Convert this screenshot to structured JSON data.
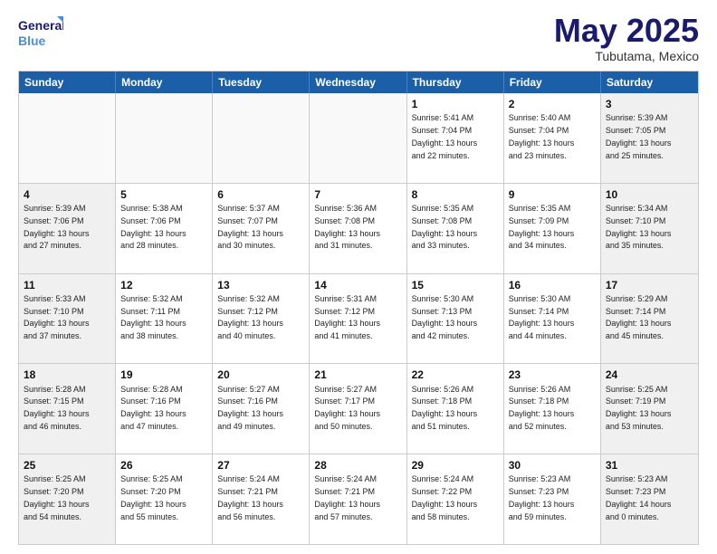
{
  "logo": {
    "line1": "General",
    "line2": "Blue"
  },
  "title": "May 2025",
  "location": "Tubutama, Mexico",
  "days": [
    "Sunday",
    "Monday",
    "Tuesday",
    "Wednesday",
    "Thursday",
    "Friday",
    "Saturday"
  ],
  "rows": [
    [
      {
        "day": "",
        "content": "",
        "empty": true
      },
      {
        "day": "",
        "content": "",
        "empty": true
      },
      {
        "day": "",
        "content": "",
        "empty": true
      },
      {
        "day": "",
        "content": "",
        "empty": true
      },
      {
        "day": "1",
        "content": "Sunrise: 5:41 AM\nSunset: 7:04 PM\nDaylight: 13 hours\nand 22 minutes.",
        "empty": false
      },
      {
        "day": "2",
        "content": "Sunrise: 5:40 AM\nSunset: 7:04 PM\nDaylight: 13 hours\nand 23 minutes.",
        "empty": false
      },
      {
        "day": "3",
        "content": "Sunrise: 5:39 AM\nSunset: 7:05 PM\nDaylight: 13 hours\nand 25 minutes.",
        "empty": false
      }
    ],
    [
      {
        "day": "4",
        "content": "Sunrise: 5:39 AM\nSunset: 7:06 PM\nDaylight: 13 hours\nand 27 minutes.",
        "empty": false
      },
      {
        "day": "5",
        "content": "Sunrise: 5:38 AM\nSunset: 7:06 PM\nDaylight: 13 hours\nand 28 minutes.",
        "empty": false
      },
      {
        "day": "6",
        "content": "Sunrise: 5:37 AM\nSunset: 7:07 PM\nDaylight: 13 hours\nand 30 minutes.",
        "empty": false
      },
      {
        "day": "7",
        "content": "Sunrise: 5:36 AM\nSunset: 7:08 PM\nDaylight: 13 hours\nand 31 minutes.",
        "empty": false
      },
      {
        "day": "8",
        "content": "Sunrise: 5:35 AM\nSunset: 7:08 PM\nDaylight: 13 hours\nand 33 minutes.",
        "empty": false
      },
      {
        "day": "9",
        "content": "Sunrise: 5:35 AM\nSunset: 7:09 PM\nDaylight: 13 hours\nand 34 minutes.",
        "empty": false
      },
      {
        "day": "10",
        "content": "Sunrise: 5:34 AM\nSunset: 7:10 PM\nDaylight: 13 hours\nand 35 minutes.",
        "empty": false
      }
    ],
    [
      {
        "day": "11",
        "content": "Sunrise: 5:33 AM\nSunset: 7:10 PM\nDaylight: 13 hours\nand 37 minutes.",
        "empty": false
      },
      {
        "day": "12",
        "content": "Sunrise: 5:32 AM\nSunset: 7:11 PM\nDaylight: 13 hours\nand 38 minutes.",
        "empty": false
      },
      {
        "day": "13",
        "content": "Sunrise: 5:32 AM\nSunset: 7:12 PM\nDaylight: 13 hours\nand 40 minutes.",
        "empty": false
      },
      {
        "day": "14",
        "content": "Sunrise: 5:31 AM\nSunset: 7:12 PM\nDaylight: 13 hours\nand 41 minutes.",
        "empty": false
      },
      {
        "day": "15",
        "content": "Sunrise: 5:30 AM\nSunset: 7:13 PM\nDaylight: 13 hours\nand 42 minutes.",
        "empty": false
      },
      {
        "day": "16",
        "content": "Sunrise: 5:30 AM\nSunset: 7:14 PM\nDaylight: 13 hours\nand 44 minutes.",
        "empty": false
      },
      {
        "day": "17",
        "content": "Sunrise: 5:29 AM\nSunset: 7:14 PM\nDaylight: 13 hours\nand 45 minutes.",
        "empty": false
      }
    ],
    [
      {
        "day": "18",
        "content": "Sunrise: 5:28 AM\nSunset: 7:15 PM\nDaylight: 13 hours\nand 46 minutes.",
        "empty": false
      },
      {
        "day": "19",
        "content": "Sunrise: 5:28 AM\nSunset: 7:16 PM\nDaylight: 13 hours\nand 47 minutes.",
        "empty": false
      },
      {
        "day": "20",
        "content": "Sunrise: 5:27 AM\nSunset: 7:16 PM\nDaylight: 13 hours\nand 49 minutes.",
        "empty": false
      },
      {
        "day": "21",
        "content": "Sunrise: 5:27 AM\nSunset: 7:17 PM\nDaylight: 13 hours\nand 50 minutes.",
        "empty": false
      },
      {
        "day": "22",
        "content": "Sunrise: 5:26 AM\nSunset: 7:18 PM\nDaylight: 13 hours\nand 51 minutes.",
        "empty": false
      },
      {
        "day": "23",
        "content": "Sunrise: 5:26 AM\nSunset: 7:18 PM\nDaylight: 13 hours\nand 52 minutes.",
        "empty": false
      },
      {
        "day": "24",
        "content": "Sunrise: 5:25 AM\nSunset: 7:19 PM\nDaylight: 13 hours\nand 53 minutes.",
        "empty": false
      }
    ],
    [
      {
        "day": "25",
        "content": "Sunrise: 5:25 AM\nSunset: 7:20 PM\nDaylight: 13 hours\nand 54 minutes.",
        "empty": false
      },
      {
        "day": "26",
        "content": "Sunrise: 5:25 AM\nSunset: 7:20 PM\nDaylight: 13 hours\nand 55 minutes.",
        "empty": false
      },
      {
        "day": "27",
        "content": "Sunrise: 5:24 AM\nSunset: 7:21 PM\nDaylight: 13 hours\nand 56 minutes.",
        "empty": false
      },
      {
        "day": "28",
        "content": "Sunrise: 5:24 AM\nSunset: 7:21 PM\nDaylight: 13 hours\nand 57 minutes.",
        "empty": false
      },
      {
        "day": "29",
        "content": "Sunrise: 5:24 AM\nSunset: 7:22 PM\nDaylight: 13 hours\nand 58 minutes.",
        "empty": false
      },
      {
        "day": "30",
        "content": "Sunrise: 5:23 AM\nSunset: 7:23 PM\nDaylight: 13 hours\nand 59 minutes.",
        "empty": false
      },
      {
        "day": "31",
        "content": "Sunrise: 5:23 AM\nSunset: 7:23 PM\nDaylight: 14 hours\nand 0 minutes.",
        "empty": false
      }
    ]
  ]
}
